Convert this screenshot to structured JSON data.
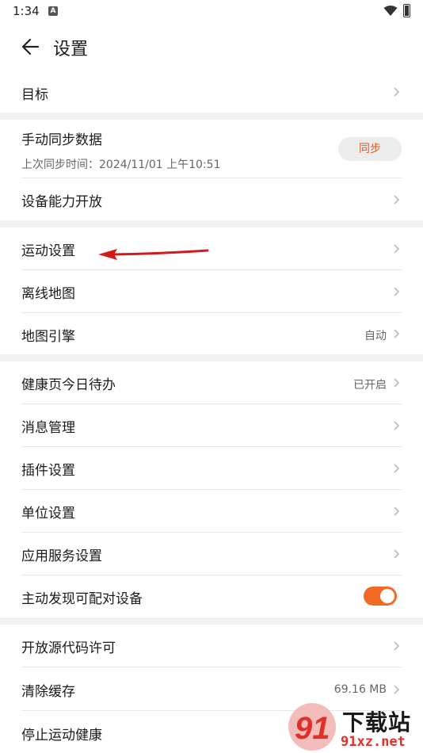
{
  "status": {
    "time": "1:34",
    "notif_icon": "A"
  },
  "header": {
    "title": "设置"
  },
  "section1": {
    "goal_label": "目标"
  },
  "section2": {
    "manual_sync_label": "手动同步数据",
    "last_sync_text": "上次同步时间：2024/11/01 上午10:51",
    "sync_button": "同步",
    "device_ability_label": "设备能力开放"
  },
  "section3": {
    "sport_settings_label": "运动设置",
    "offline_map_label": "离线地图",
    "map_engine_label": "地图引擎",
    "map_engine_value": "自动"
  },
  "section4": {
    "health_today_label": "健康页今日待办",
    "health_today_value": "已开启",
    "message_mgmt_label": "消息管理",
    "plugin_settings_label": "插件设置",
    "unit_settings_label": "单位设置",
    "app_service_label": "应用服务设置",
    "discover_devices_label": "主动发现可配对设备",
    "discover_devices_on": true
  },
  "section5": {
    "open_source_label": "开放源代码许可",
    "clear_cache_label": "清除缓存",
    "clear_cache_value": "69.16 MB",
    "stop_health_label": "停止运动健康"
  },
  "watermark": {
    "text": "下载站",
    "url": "91xz.net"
  },
  "colors": {
    "accent": "#f36a25",
    "sync_text": "#e4571f",
    "annotation_arrow": "#d11a1a"
  }
}
